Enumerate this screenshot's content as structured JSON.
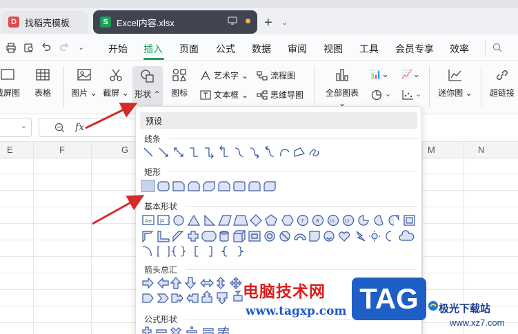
{
  "tabs": [
    {
      "label": "找稻壳模板"
    },
    {
      "label": "Excel内容.xlsx"
    }
  ],
  "excel_tab_icon": "S",
  "doc_tab_icon": "D",
  "menu": {
    "items": [
      "开始",
      "插入",
      "页面",
      "公式",
      "数据",
      "审阅",
      "视图",
      "工具",
      "会员专享",
      "效率"
    ],
    "active": "插入"
  },
  "ribbon": {
    "screenshot_label": "截屏图",
    "table_label": "表格",
    "picture_label": "图片",
    "capture_label": "截屏",
    "shape_label": "形状",
    "icon_label": "图标",
    "wordart_label": "艺术字",
    "textbox_label": "文本框",
    "flowchart_label": "流程图",
    "mindmap_label": "思维导图",
    "allcharts_label": "全部图表",
    "sparkline_label": "迷你图",
    "hyperlink_label": "超链接"
  },
  "formula_bar": {
    "fx_label": "fx"
  },
  "columns": [
    "E",
    "F",
    "G",
    "M",
    "N"
  ],
  "shapes_panel": {
    "preset": "预设",
    "sections": [
      "线条",
      "矩形",
      "基本形状",
      "箭头总汇",
      "公式形状"
    ]
  },
  "watermark": {
    "text": "电脑技术网",
    "url": "www.tagxp.com",
    "logo": "TAG",
    "site_name": "极光下载站",
    "site_url": "www.xz7.com"
  },
  "colors": {
    "accent": "#1e9e58",
    "shape_stroke": "#3b5aa3",
    "arrow": "#d42a2a"
  }
}
